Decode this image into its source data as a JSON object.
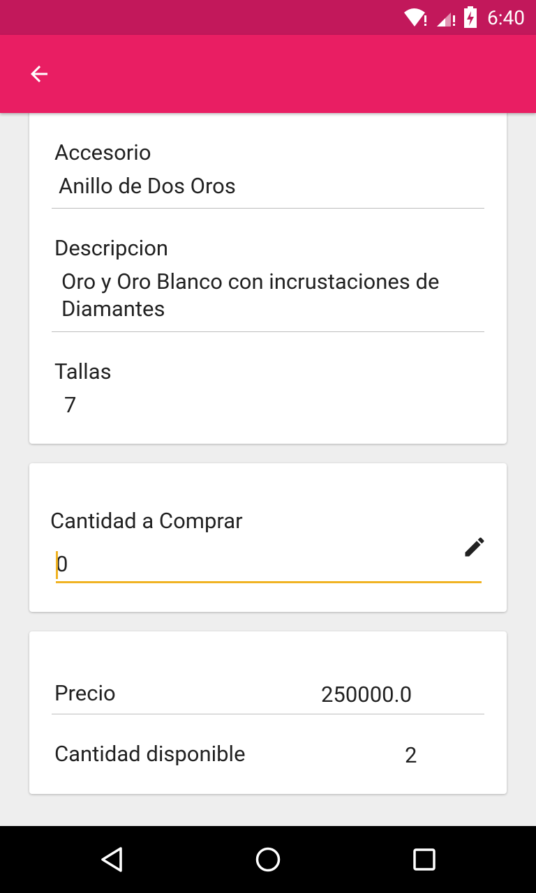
{
  "status_bar": {
    "time": "6:40",
    "icons": [
      "wifi-alert-icon",
      "signal-alert-icon",
      "battery-charging-icon"
    ],
    "color": "#c2185b"
  },
  "app_bar": {
    "color": "#e91e63",
    "back_icon": "arrow-back-icon"
  },
  "product": {
    "accessory_label": "Accesorio",
    "accessory_value": "Anillo de Dos Oros",
    "description_label": "Descripcion",
    "description_line1": "Oro y Oro Blanco con incrustaciones de",
    "description_line2": "Diamantes",
    "sizes_label": "Tallas",
    "sizes_value": "7"
  },
  "purchase": {
    "quantity_label": "Cantidad a Comprar",
    "quantity_value": "0",
    "edit_icon": "pencil-icon",
    "accent_color": "#f0b323"
  },
  "pricing": {
    "price_label": "Precio",
    "price_value": "250000.0",
    "available_label": "Cantidad disponible",
    "available_value": "2"
  },
  "nav_bar": {
    "icons": [
      "back-triangle-icon",
      "home-circle-icon",
      "recents-square-icon"
    ]
  }
}
